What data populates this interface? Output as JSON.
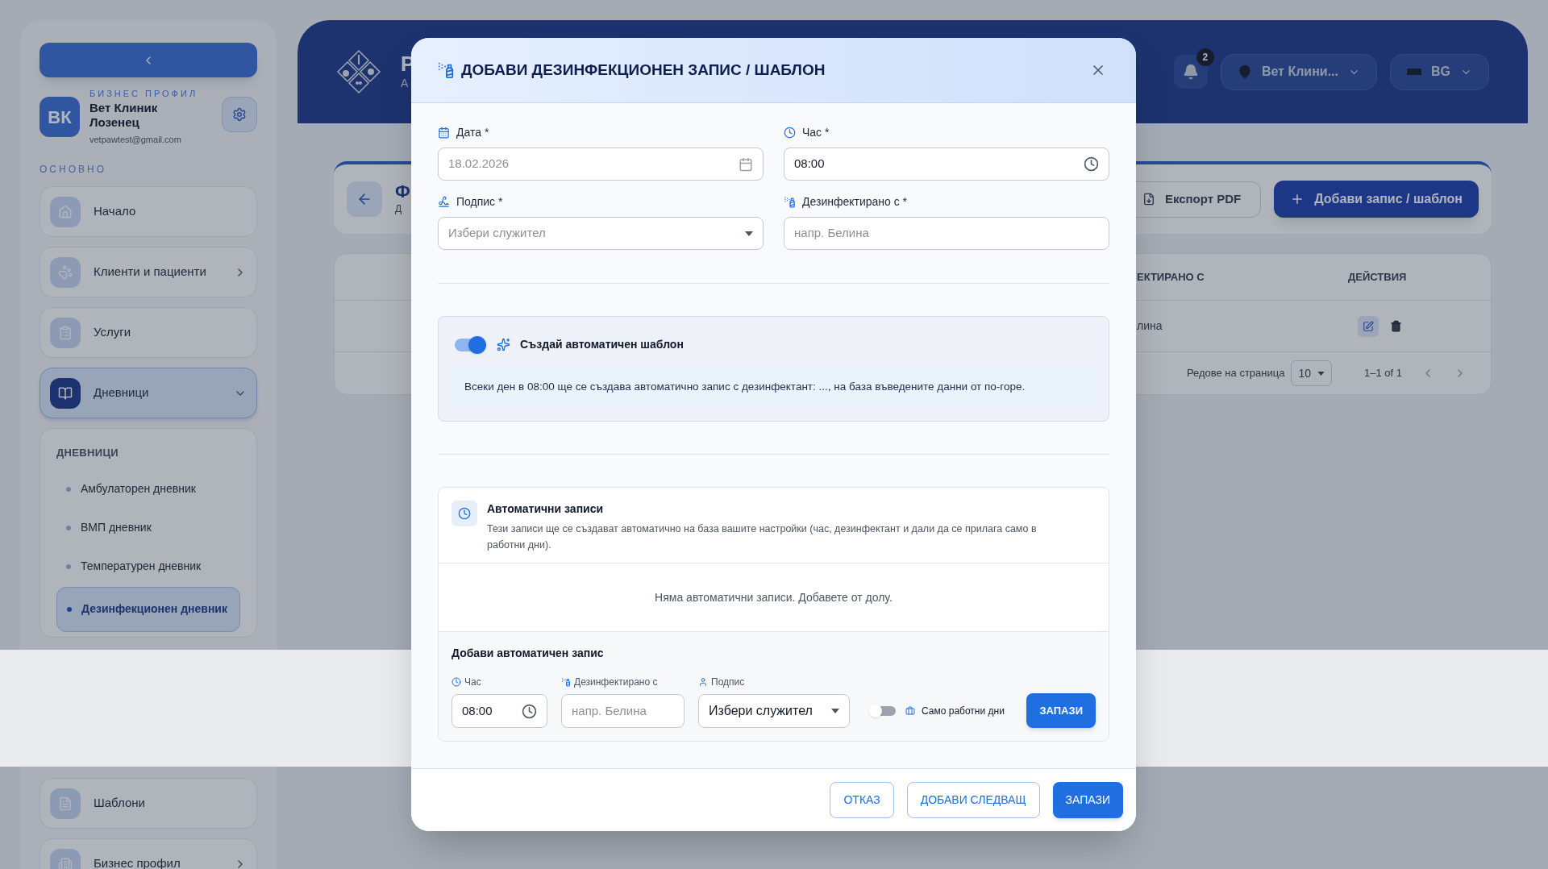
{
  "sidebar": {
    "profile": {
      "initials": "ВК",
      "label": "БИЗНЕС ПРОФИЛ",
      "name": "Вет Клиник Лозенец",
      "email": "vetpawtest@gmail.com"
    },
    "section_label": "ОСНОВНО",
    "nav_items": [
      {
        "label": "Начало",
        "expandable": false,
        "selected": false
      },
      {
        "label": "Клиенти и пациенти",
        "expandable": true,
        "selected": false
      },
      {
        "label": "Услуги",
        "expandable": false,
        "selected": false
      },
      {
        "label": "Дневници",
        "expandable": true,
        "selected": true
      }
    ],
    "submenu": {
      "title": "ДНЕВНИЦИ",
      "items": [
        {
          "label": "Амбулаторен дневник",
          "selected": false
        },
        {
          "label": "ВМП дневник",
          "selected": false
        },
        {
          "label": "Температурен дневник",
          "selected": false
        },
        {
          "label": "Дезинфекционен дневник",
          "selected": true
        }
      ]
    },
    "nav_items_after": [
      {
        "label": "Шаблони",
        "expandable": false,
        "selected": false
      },
      {
        "label": "Бизнес профил",
        "expandable": true,
        "selected": false
      }
    ]
  },
  "header": {
    "title": "Р",
    "subtitle": "А",
    "notifications": "2",
    "clinic": "Вет Клини...",
    "language": "BG"
  },
  "toolbar": {
    "title": "Ф",
    "subtitle": "Д",
    "export_button": "Експорт PDF",
    "add_button": "Добави запис / шаблон"
  },
  "table": {
    "columns": [
      "ЕКТИРАНО С",
      "ДЕЙСТВИЯ"
    ],
    "rows": [
      {
        "cells": [
          "лина"
        ]
      }
    ],
    "pagination": {
      "label": "Редове на страница",
      "rows_per_page": "10",
      "range": "1–1 of 1"
    }
  },
  "modal": {
    "title": "ДОБАВИ ДЕЗИНФЕКЦИОНЕН ЗАПИС / ШАБЛОН",
    "fields": [
      {
        "label": "Дата *",
        "kind": "date",
        "value": "18.02.2026",
        "disabled": true
      },
      {
        "label": "Час *",
        "kind": "time",
        "value": "08:00",
        "disabled": false
      },
      {
        "label": "Подпис *",
        "kind": "select",
        "placeholder": "Избери служител"
      },
      {
        "label": "Дезинфектирано с *",
        "kind": "text",
        "placeholder": "напр. Белина"
      }
    ],
    "template": {
      "on": true,
      "label": "Създай автоматичен шаблон",
      "info": "Всеки ден в 08:00 ще се създава автоматично запис с дезинфектант: ..., на база въведените данни от по-горе."
    },
    "auto_records": {
      "title": "Автоматични записи",
      "description": "Тези записи ще се създават автоматично на база вашите настройки (час, дезинфектант и дали да се прилага само в работни дни).",
      "empty_text": "Няма автоматични записи. Добавете от долу.",
      "add_form": {
        "title": "Добави автоматичен запис",
        "fields": [
          {
            "label": "Час",
            "kind": "time",
            "value": "08:00"
          },
          {
            "label": "Дезинфектирано с",
            "kind": "text",
            "placeholder": "напр. Белина"
          },
          {
            "label": "Подпис",
            "kind": "select",
            "value": "Избери служител"
          }
        ],
        "working_days": {
          "label": "Само работни дни",
          "on": false
        },
        "save_button": "ЗАПАЗИ"
      }
    },
    "buttons": [
      {
        "label": "ОТКАЗ",
        "kind": "outlined"
      },
      {
        "label": "ДОБАВИ СЛЕДВАЩ",
        "kind": "outlined"
      },
      {
        "label": "ЗАПАЗИ",
        "kind": "filled"
      }
    ]
  }
}
